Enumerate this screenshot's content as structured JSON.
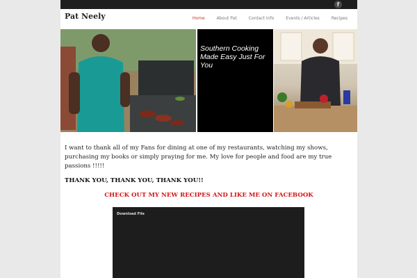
{
  "topbar": {
    "facebook_icon_glyph": "f"
  },
  "header": {
    "site_title": "Pat Neely",
    "nav": [
      "Home",
      "About Pat",
      "Contact Info",
      "Events / Articles",
      "Recipes"
    ],
    "active_nav": "Home",
    "active_color": "#c23a2b"
  },
  "hero": {
    "tagline": "Southern Cooking Made Easy Just For You"
  },
  "main": {
    "intro": "I want to thank all of my Fans for dining at one of my restaurants, watching my shows, purchasing my books or simply praying for me.  My love for people and food are my true passions !!!!!",
    "thanks": "THANK YOU, THANK YOU, THANK YOU!!",
    "cta": "CHECK OUT MY NEW RECIPES AND LIKE ME ON FACEBOOK",
    "cta_color": "#d01616"
  },
  "video": {
    "label": "Download File"
  }
}
